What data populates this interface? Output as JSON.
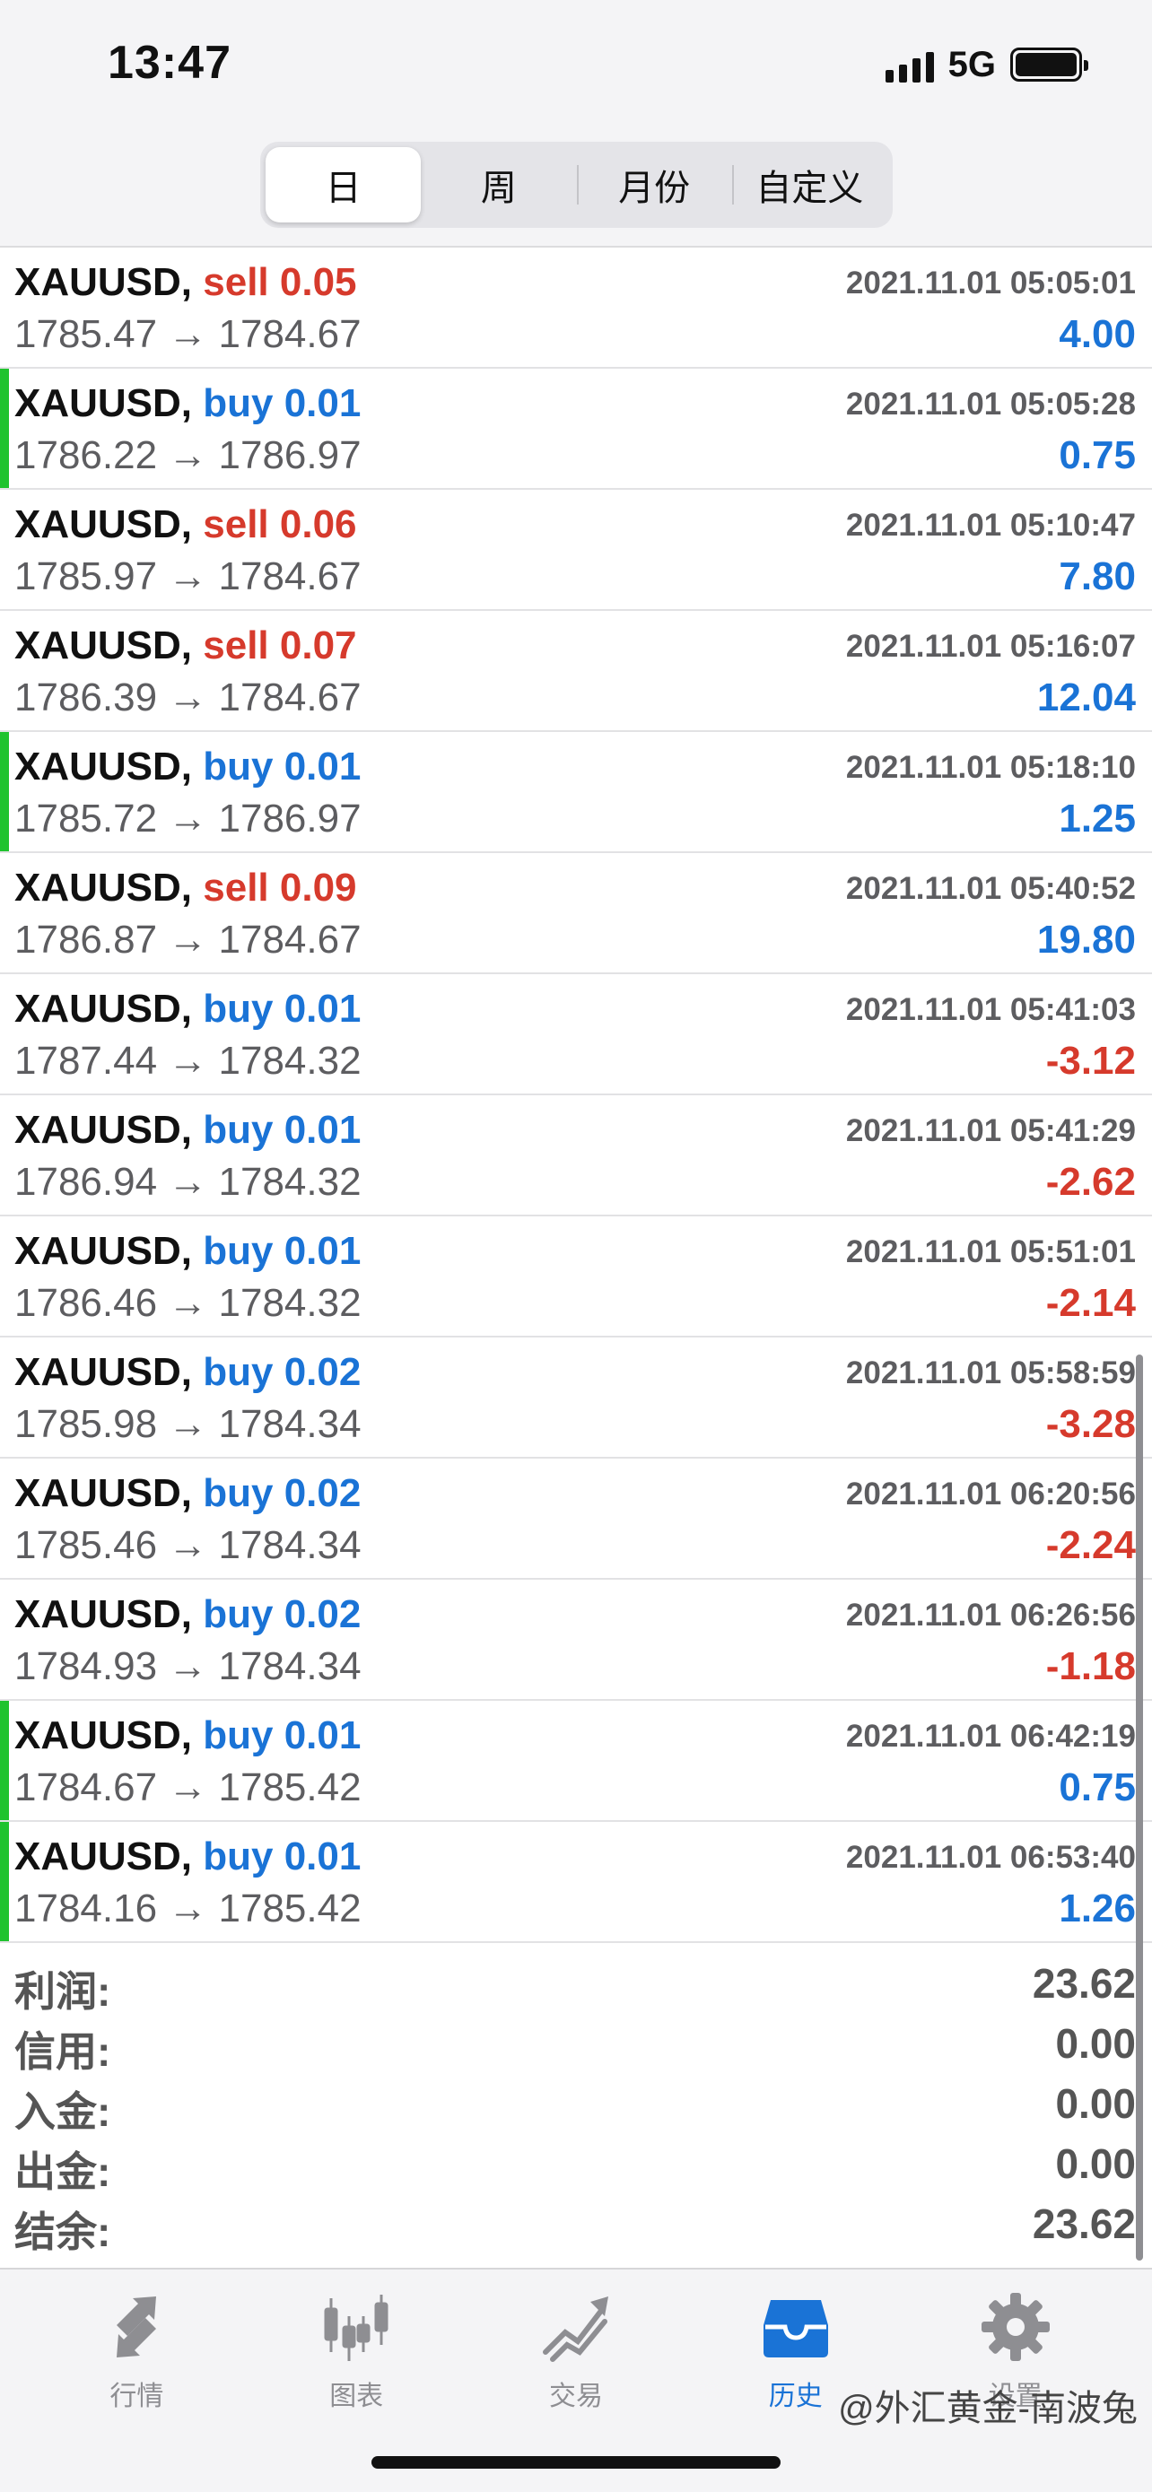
{
  "status_bar": {
    "time": "13:47",
    "network": "5G"
  },
  "segments": [
    {
      "label": "日",
      "active": true
    },
    {
      "label": "周",
      "active": false
    },
    {
      "label": "月份",
      "active": false
    },
    {
      "label": "自定义",
      "active": false
    }
  ],
  "trades": [
    {
      "symbol": "XAUUSD,",
      "side": "sell",
      "side_label": "sell 0.05",
      "datetime": "2021.11.01 05:05:01",
      "prices": "1785.47 → 1784.67",
      "profit": "4.00",
      "profit_sign": "pos",
      "marker": false
    },
    {
      "symbol": "XAUUSD,",
      "side": "buy",
      "side_label": "buy 0.01",
      "datetime": "2021.11.01 05:05:28",
      "prices": "1786.22 → 1786.97",
      "profit": "0.75",
      "profit_sign": "pos",
      "marker": true
    },
    {
      "symbol": "XAUUSD,",
      "side": "sell",
      "side_label": "sell 0.06",
      "datetime": "2021.11.01 05:10:47",
      "prices": "1785.97 → 1784.67",
      "profit": "7.80",
      "profit_sign": "pos",
      "marker": false
    },
    {
      "symbol": "XAUUSD,",
      "side": "sell",
      "side_label": "sell 0.07",
      "datetime": "2021.11.01 05:16:07",
      "prices": "1786.39 → 1784.67",
      "profit": "12.04",
      "profit_sign": "pos",
      "marker": false
    },
    {
      "symbol": "XAUUSD,",
      "side": "buy",
      "side_label": "buy 0.01",
      "datetime": "2021.11.01 05:18:10",
      "prices": "1785.72 → 1786.97",
      "profit": "1.25",
      "profit_sign": "pos",
      "marker": true
    },
    {
      "symbol": "XAUUSD,",
      "side": "sell",
      "side_label": "sell 0.09",
      "datetime": "2021.11.01 05:40:52",
      "prices": "1786.87 → 1784.67",
      "profit": "19.80",
      "profit_sign": "pos",
      "marker": false
    },
    {
      "symbol": "XAUUSD,",
      "side": "buy",
      "side_label": "buy 0.01",
      "datetime": "2021.11.01 05:41:03",
      "prices": "1787.44 → 1784.32",
      "profit": "-3.12",
      "profit_sign": "neg",
      "marker": false
    },
    {
      "symbol": "XAUUSD,",
      "side": "buy",
      "side_label": "buy 0.01",
      "datetime": "2021.11.01 05:41:29",
      "prices": "1786.94 → 1784.32",
      "profit": "-2.62",
      "profit_sign": "neg",
      "marker": false
    },
    {
      "symbol": "XAUUSD,",
      "side": "buy",
      "side_label": "buy 0.01",
      "datetime": "2021.11.01 05:51:01",
      "prices": "1786.46 → 1784.32",
      "profit": "-2.14",
      "profit_sign": "neg",
      "marker": false
    },
    {
      "symbol": "XAUUSD,",
      "side": "buy",
      "side_label": "buy 0.02",
      "datetime": "2021.11.01 05:58:59",
      "prices": "1785.98 → 1784.34",
      "profit": "-3.28",
      "profit_sign": "neg",
      "marker": false
    },
    {
      "symbol": "XAUUSD,",
      "side": "buy",
      "side_label": "buy 0.02",
      "datetime": "2021.11.01 06:20:56",
      "prices": "1785.46 → 1784.34",
      "profit": "-2.24",
      "profit_sign": "neg",
      "marker": false
    },
    {
      "symbol": "XAUUSD,",
      "side": "buy",
      "side_label": "buy 0.02",
      "datetime": "2021.11.01 06:26:56",
      "prices": "1784.93 → 1784.34",
      "profit": "-1.18",
      "profit_sign": "neg",
      "marker": false
    },
    {
      "symbol": "XAUUSD,",
      "side": "buy",
      "side_label": "buy 0.01",
      "datetime": "2021.11.01 06:42:19",
      "prices": "1784.67 → 1785.42",
      "profit": "0.75",
      "profit_sign": "pos",
      "marker": true
    },
    {
      "symbol": "XAUUSD,",
      "side": "buy",
      "side_label": "buy 0.01",
      "datetime": "2021.11.01 06:53:40",
      "prices": "1784.16 → 1785.42",
      "profit": "1.26",
      "profit_sign": "pos",
      "marker": true
    }
  ],
  "summary": [
    {
      "label": "利润:",
      "value": "23.62"
    },
    {
      "label": "信用:",
      "value": "0.00"
    },
    {
      "label": "入金:",
      "value": "0.00"
    },
    {
      "label": "出金:",
      "value": "0.00"
    },
    {
      "label": "结余:",
      "value": "23.62"
    }
  ],
  "tabs": [
    {
      "label": "行情",
      "icon": "quotes-arrows-icon",
      "active": false
    },
    {
      "label": "图表",
      "icon": "candlestick-chart-icon",
      "active": false
    },
    {
      "label": "交易",
      "icon": "trade-trend-icon",
      "active": false
    },
    {
      "label": "历史",
      "icon": "history-inbox-icon",
      "active": true
    },
    {
      "label": "设置",
      "icon": "gear-icon",
      "active": false
    }
  ],
  "watermark": "@外汇黄金-南波兔",
  "colors": {
    "sell": "#d63a2c",
    "buy": "#1a73d6",
    "marker": "#1fc32e",
    "active_tab": "#1a73d6"
  }
}
